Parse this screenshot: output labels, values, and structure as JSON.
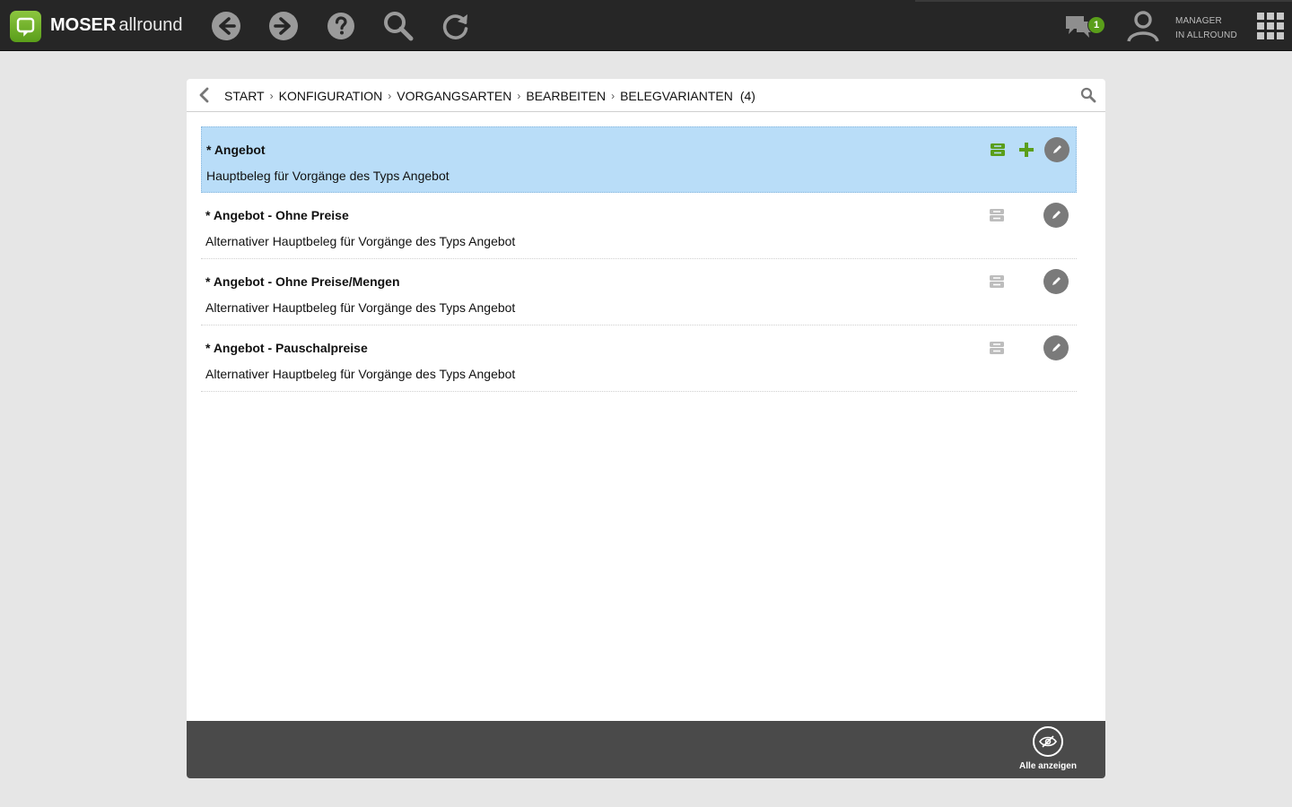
{
  "app": {
    "brand_bold": "MOSER",
    "brand_light": "allround",
    "nav": {
      "back_icon": "arrow-left-icon",
      "forward_icon": "arrow-right-icon",
      "help_icon": "help-icon",
      "search_icon": "search-icon",
      "refresh_icon": "refresh-icon"
    },
    "messages_badge": "1",
    "user_line1": "MANAGER",
    "user_line2": "IN ALLROUND",
    "accent_color": "#5a9e1a"
  },
  "breadcrumb": {
    "items": [
      "START",
      "KONFIGURATION",
      "VORGANGSARTEN",
      "BEARBEITEN",
      "BELEGVARIANTEN"
    ],
    "separator": "›",
    "count": "(4)"
  },
  "list": {
    "rows": [
      {
        "title": "* Angebot",
        "desc": "Hauptbeleg für Vorgänge des Typs Angebot",
        "selected": true
      },
      {
        "title": "* Angebot - Ohne Preise",
        "desc": "Alternativer Hauptbeleg für Vorgänge des Typs Angebot",
        "selected": false
      },
      {
        "title": "* Angebot - Ohne Preise/Mengen",
        "desc": "Alternativer Hauptbeleg für Vorgänge des Typs Angebot",
        "selected": false
      },
      {
        "title": "* Angebot - Pauschalpreise",
        "desc": "Alternativer Hauptbeleg für Vorgänge des Typs Angebot",
        "selected": false
      }
    ]
  },
  "footer": {
    "show_all_label": "Alle anzeigen"
  }
}
